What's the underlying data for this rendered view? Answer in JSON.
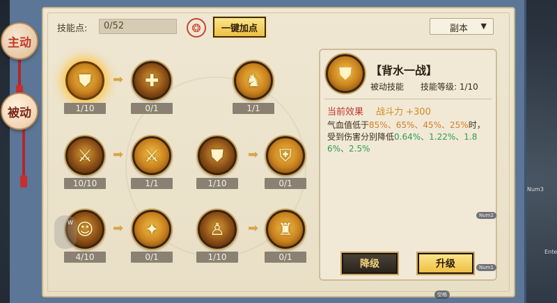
{
  "side_tabs": {
    "active": "主动",
    "passive": "被动"
  },
  "top_bar": {
    "points_label": "技能点:",
    "points_value": "0/52",
    "auto_button": "一键加点",
    "dropdown_value": "副本",
    "dropdown_caret": "▼",
    "swirl_glyph": "❂"
  },
  "tree": {
    "arrow_glyph": "➡",
    "nodes": [
      {
        "count": "1/10",
        "glyph": "⛊",
        "icon": "shield-coin-icon",
        "glow": true
      },
      {
        "count": "0/1",
        "glyph": "✚",
        "icon": "shield-plus-icon",
        "glow": false
      },
      {
        "count": "1/1",
        "glyph": "♞",
        "icon": "dragon-rider-icon",
        "glow": false
      },
      {
        "count": "10/10",
        "glyph": "⚔",
        "icon": "blades-icon",
        "glow": false
      },
      {
        "count": "1/1",
        "glyph": "⚔",
        "icon": "blades-upgrade-icon",
        "glow": false
      },
      {
        "count": "1/10",
        "glyph": "⛊",
        "icon": "gold-shield-icon",
        "glow": false
      },
      {
        "count": "0/1",
        "glyph": "⛨",
        "icon": "armor-icon",
        "glow": false
      },
      {
        "count": "4/10",
        "glyph": "☺",
        "icon": "mask-icon",
        "glow": false
      },
      {
        "count": "0/1",
        "glyph": "✦",
        "icon": "warrior-aura-icon",
        "glow": false
      },
      {
        "count": "1/10",
        "glyph": "♙",
        "icon": "soldier-icon",
        "glow": false
      },
      {
        "count": "0/1",
        "glyph": "♜",
        "icon": "spread-arms-icon",
        "glow": false
      }
    ]
  },
  "detail": {
    "name": "【背水一战】",
    "type": "被动技能",
    "level_label": "技能等级: 1/10",
    "effect_label": "当前效果",
    "effect_value": "战斗力 +300",
    "desc_prefix": "气血值低于",
    "desc_thresholds": "85%、65%、45%、25%",
    "desc_mid": "时，受到伤害分别降低",
    "desc_values": "0.64%、1.22%、1.86%、2.5%",
    "btn_downgrade": "降级",
    "btn_upgrade": "升级"
  },
  "overlay": {
    "num3": "Num3",
    "num2": "Num2",
    "num1": "Num1",
    "ente": "Ente",
    "w_key": "W",
    "bottom_tag": "空格"
  },
  "colors": {
    "accent_red": "#c0392b",
    "effect_orange": "#d28a1e",
    "value_green": "#2e9f4f",
    "gold_button": "#eec044"
  }
}
